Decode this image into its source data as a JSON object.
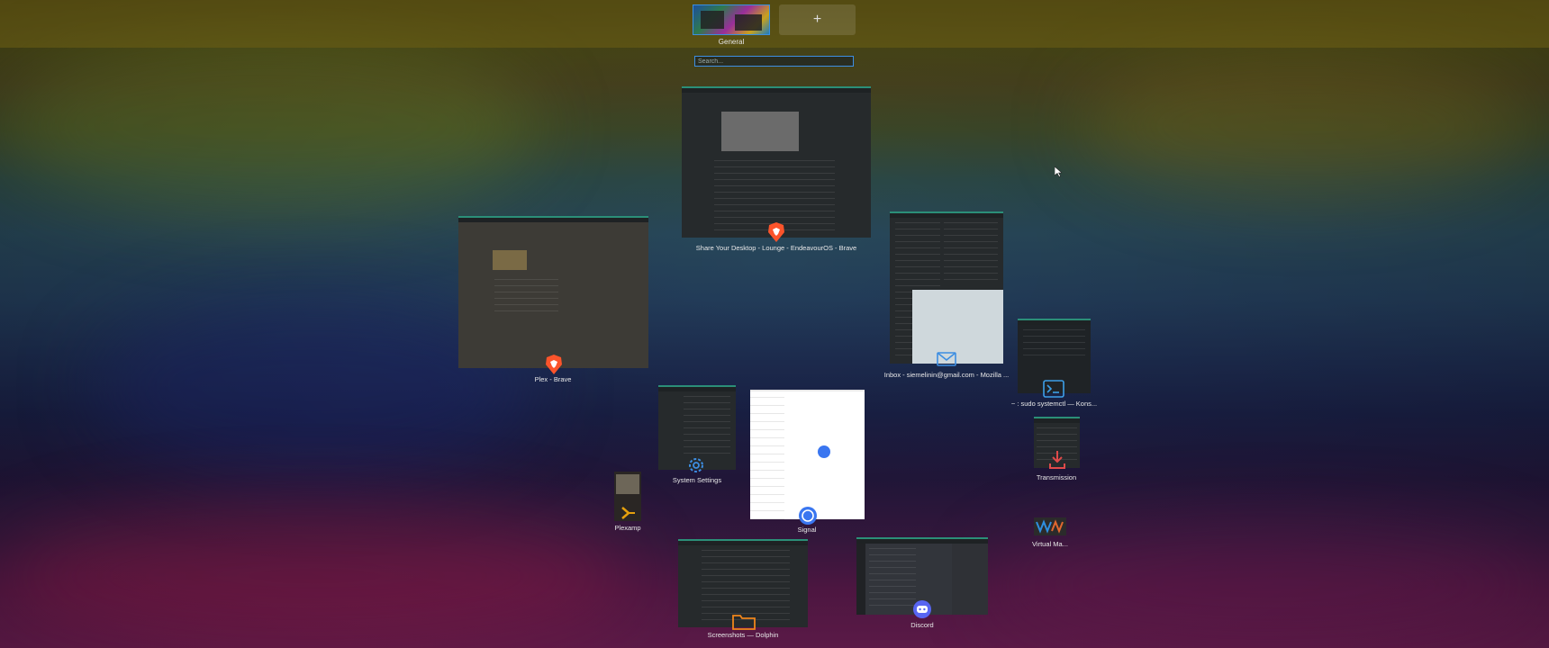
{
  "desktops": [
    {
      "label": "General"
    }
  ],
  "add_desktop_label": "+",
  "search": {
    "placeholder": "Search..."
  },
  "windows": [
    {
      "title": "Share Your Desktop - Lounge - EndeavourOS - Brave",
      "app": "brave-icon"
    },
    {
      "title": "Plex - Brave",
      "app": "brave-icon"
    },
    {
      "title": "Inbox - siemelinin@gmail.com - Mozilla ...",
      "app": "mail-icon"
    },
    {
      "title": "~ : sudo systemctl — Kons...",
      "app": "terminal-icon"
    },
    {
      "title": "System Settings",
      "app": "settings-gear-icon"
    },
    {
      "title": "Signal",
      "app": "signal-icon"
    },
    {
      "title": "Transmission",
      "app": "transmission-icon"
    },
    {
      "title": "Plexamp",
      "app": "plexamp-icon"
    },
    {
      "title": "Virtual Ma...",
      "app": "virtual-machine-icon"
    },
    {
      "title": "Screenshots — Dolphin",
      "app": "folder-icon"
    },
    {
      "title": "Discord",
      "app": "discord-icon"
    }
  ],
  "colors": {
    "accent": "#3d8ee2",
    "window_border": "#2b8f78",
    "brave": "#fb542b",
    "discord": "#5865f2",
    "signal": "#3a76f0",
    "folder": "#f0851b"
  }
}
